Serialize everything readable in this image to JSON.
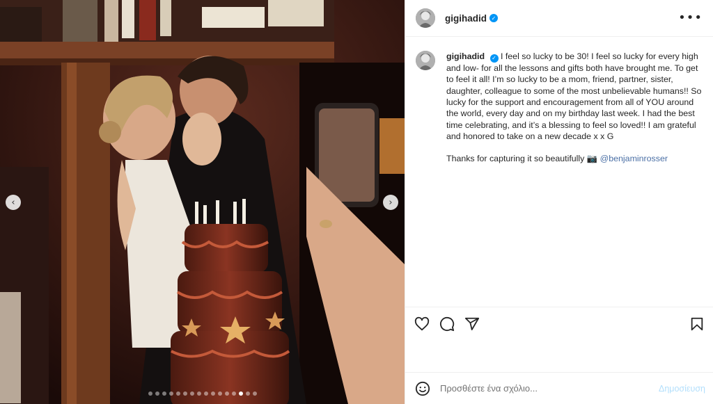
{
  "post": {
    "username": "gigihadid",
    "verified": true,
    "more_label": "•••"
  },
  "caption": {
    "username": "gigihadid",
    "text": "I feel so lucky to be 30! I feel so lucky for every high and low- for all the lessons and gifts both have brought me. To get to feel it all! I’m so lucky to be a mom, friend, partner, sister, daughter, colleague to some of the most unbelievable humans!! So lucky for the support and encouragement from all of YOU around the world, every day and on my birthday last week. I had the best time celebrating, and it’s a blessing to feel so loved!! I am grateful and honored to take on a new decade x x G",
    "thanks_text": "Thanks for capturing it so beautifully 📷 ",
    "mention": "@benjaminrosser"
  },
  "carousel": {
    "prev_icon": "chevron-left-icon",
    "next_icon": "chevron-right-icon",
    "dot_count": 16,
    "active_dot": 13
  },
  "actions": {
    "like_icon": "heart-icon",
    "comment_icon": "comment-icon",
    "share_icon": "share-icon",
    "save_icon": "bookmark-icon"
  },
  "comment": {
    "placeholder": "Προσθέστε ένα σχόλιο...",
    "post_label": "Δημοσίευση",
    "emoji_icon": "emoji-icon"
  },
  "colors": {
    "verified": "#0095f6",
    "mention": "#4a6fa5",
    "post_disabled": "#b2dffc",
    "border": "#efefef"
  }
}
